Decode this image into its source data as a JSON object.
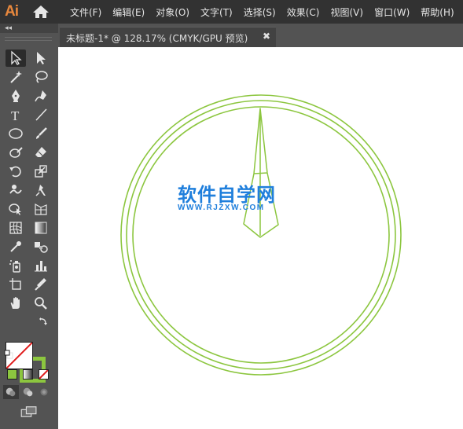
{
  "app": {
    "logo_text": "Ai",
    "home_icon": "home-icon",
    "menu": [
      "文件(F)",
      "编辑(E)",
      "对象(O)",
      "文字(T)",
      "选择(S)",
      "效果(C)",
      "视图(V)",
      "窗口(W)",
      "帮助(H)"
    ]
  },
  "toolbar": {
    "collapse_label": "◂◂",
    "tools": [
      {
        "name": "selection-tool-icon",
        "selected": true
      },
      {
        "name": "direct-selection-tool-icon"
      },
      {
        "name": "magic-wand-tool-icon"
      },
      {
        "name": "lasso-tool-icon"
      },
      {
        "name": "pen-tool-icon"
      },
      {
        "name": "curvature-tool-icon"
      },
      {
        "name": "type-tool-icon"
      },
      {
        "name": "line-segment-tool-icon"
      },
      {
        "name": "ellipse-tool-icon"
      },
      {
        "name": "paintbrush-tool-icon"
      },
      {
        "name": "shaper-tool-icon"
      },
      {
        "name": "eraser-tool-icon"
      },
      {
        "name": "rotate-tool-icon"
      },
      {
        "name": "scale-tool-icon"
      },
      {
        "name": "warp-tool-icon"
      },
      {
        "name": "free-transform-tool-icon"
      },
      {
        "name": "shape-builder-tool-icon"
      },
      {
        "name": "perspective-grid-tool-icon"
      },
      {
        "name": "mesh-tool-icon"
      },
      {
        "name": "gradient-tool-icon"
      },
      {
        "name": "eyedropper-tool-icon"
      },
      {
        "name": "blend-tool-icon"
      },
      {
        "name": "symbol-sprayer-tool-icon"
      },
      {
        "name": "column-graph-tool-icon"
      },
      {
        "name": "artboard-tool-icon"
      },
      {
        "name": "slice-tool-icon"
      },
      {
        "name": "hand-tool-icon"
      },
      {
        "name": "zoom-tool-icon"
      }
    ],
    "fill_color": "#ffffff",
    "stroke_color": "#8cc63f"
  },
  "document": {
    "tab_title": "未标题-1* @ 128.17% (CMYK/GPU 预览)",
    "close_label": "✖"
  },
  "canvas": {
    "stroke_color": "#8cc63f",
    "watermark_main": "软件自学网",
    "watermark_sub": "WWW.RJZXW.COM",
    "watermark_color": "#1f7fdc"
  }
}
